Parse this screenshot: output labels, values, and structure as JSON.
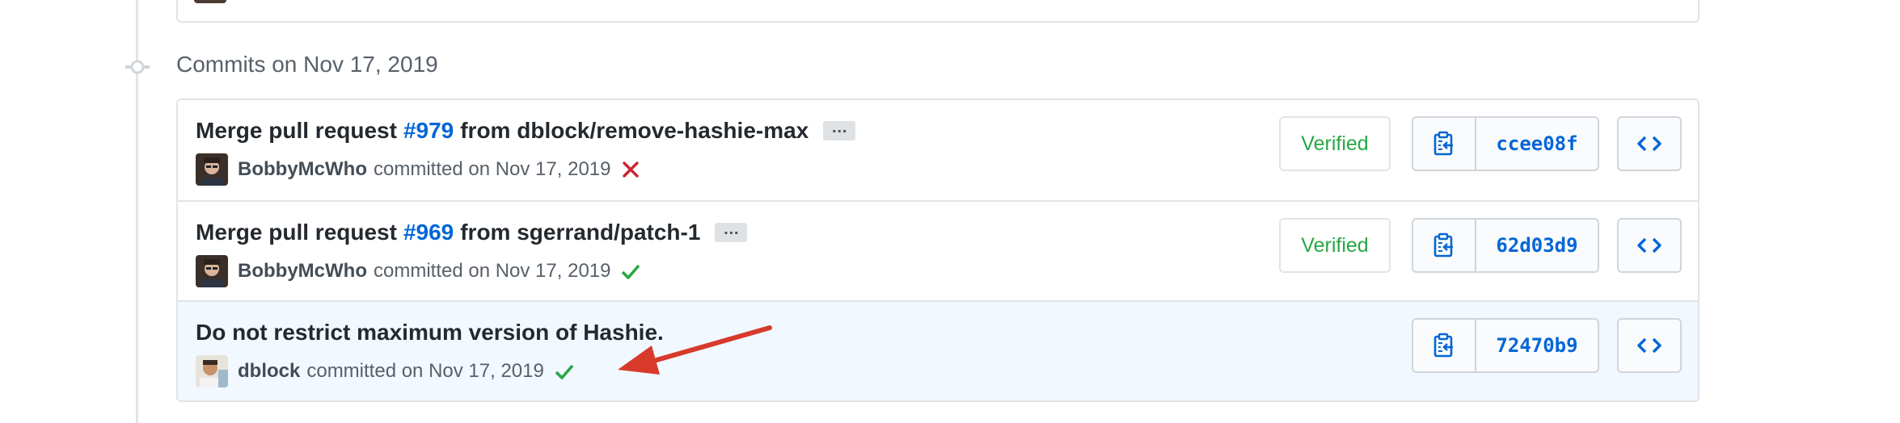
{
  "group": {
    "title": "Commits on Nov 17, 2019"
  },
  "commits": [
    {
      "title_prefix": "Merge pull request",
      "pr": "#979",
      "title_suffix": "from dblock/remove-hashie-max",
      "author": "BobbyMcWho",
      "meta": "committed on Nov 17, 2019",
      "status": "failure",
      "verified": "Verified",
      "sha": "ccee08f"
    },
    {
      "title_prefix": "Merge pull request",
      "pr": "#969",
      "title_suffix": "from sgerrand/patch-1",
      "author": "BobbyMcWho",
      "meta": "committed on Nov 17, 2019",
      "status": "success",
      "verified": "Verified",
      "sha": "62d03d9"
    },
    {
      "title": "Do not restrict maximum version of Hashie.",
      "author": "dblock",
      "meta": "committed on Nov 17, 2019",
      "status": "success",
      "sha": "72470b9"
    }
  ],
  "icons": {
    "copy": "clipboard-icon",
    "browse": "code-icon",
    "failure": "x-icon",
    "success": "check-icon",
    "commit_node": "git-commit-icon"
  },
  "colors": {
    "link": "#0366d6",
    "success": "#28a745",
    "failure": "#cb2431",
    "annotation": "#d73a2a",
    "highlight_row": "#f1f8ff"
  }
}
